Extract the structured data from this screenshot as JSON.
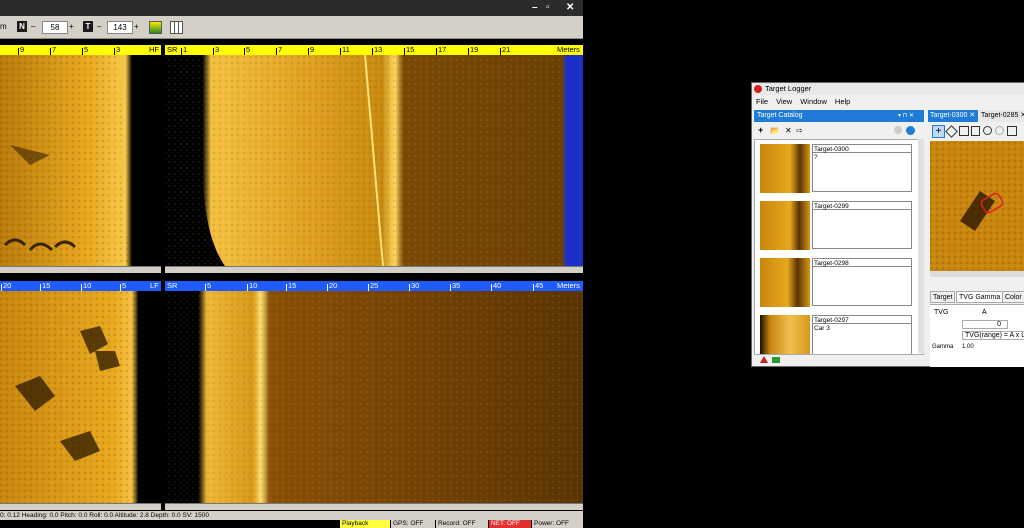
{
  "sonar": {
    "window_controls": {
      "minimize": "–",
      "maximize": "▫",
      "close": "✕"
    },
    "toolbar": {
      "unit_fragment": "m",
      "n_label": "N",
      "n_minus": "–",
      "n_value": "58",
      "n_plus": "+",
      "t_label": "T",
      "t_minus": "–",
      "t_value": "143",
      "t_plus": "+"
    },
    "top_port_ruler": {
      "ticks": [
        "9",
        "7",
        "5",
        "3"
      ],
      "side": "HF"
    },
    "top_starboard_ruler": {
      "side": "SR",
      "ticks": [
        "1",
        "3",
        "5",
        "7",
        "9",
        "11",
        "13",
        "15",
        "17",
        "19",
        "21"
      ],
      "unit": "Meters"
    },
    "bottom_port_ruler": {
      "ticks": [
        "20",
        "15",
        "10",
        "5"
      ],
      "side": "LF"
    },
    "bottom_starboard_ruler": {
      "side": "SR",
      "ticks": [
        "5",
        "10",
        "15",
        "20",
        "25",
        "30",
        "35",
        "40",
        "45"
      ],
      "unit": "Meters"
    },
    "status_line": "0: 0.12   Heading: 0.0   Pitch: 0.0   Roll: 0.0   Altitude: 2.8   Depth: 0.0   SV: 1500",
    "status": {
      "playback": "Playback",
      "gps": "GPS: OFF",
      "record": "Record: OFF",
      "net": "NET: OFF",
      "power": "Power: OFF"
    },
    "colors": {
      "ruler_yellow": "#ffff00",
      "ruler_blue": "#1f5bff",
      "net_red": "#e03030",
      "playback_yellow": "#ffff40"
    }
  },
  "target_logger": {
    "title": "Target Logger",
    "menu": [
      "File",
      "View",
      "Window",
      "Help"
    ],
    "catalog": {
      "title": "Target Catalog",
      "pin": "▾ ⊓ ✕",
      "toolbar": {
        "add": "+",
        "open": "📂",
        "delete": "✕",
        "export": "⇨"
      },
      "items": [
        {
          "name": "Target-0300",
          "notes": "?"
        },
        {
          "name": "Target-0299",
          "notes": ""
        },
        {
          "name": "Target-0298",
          "notes": ""
        },
        {
          "name": "Target-0297",
          "notes": "Car 3"
        }
      ]
    },
    "tabs": [
      {
        "label": "Target-0300",
        "close": "✕"
      },
      {
        "label": "Target-0285",
        "close": "✕"
      }
    ],
    "viewer_tabs": [
      "Target",
      "TVG Gamma",
      "Color"
    ],
    "tvg": {
      "label": "TVG",
      "col_a": "A",
      "a_value": "0",
      "formula": "TVG(range) = A x Lo",
      "gamma_label": "Gamma",
      "gamma_value": "1.00"
    }
  }
}
